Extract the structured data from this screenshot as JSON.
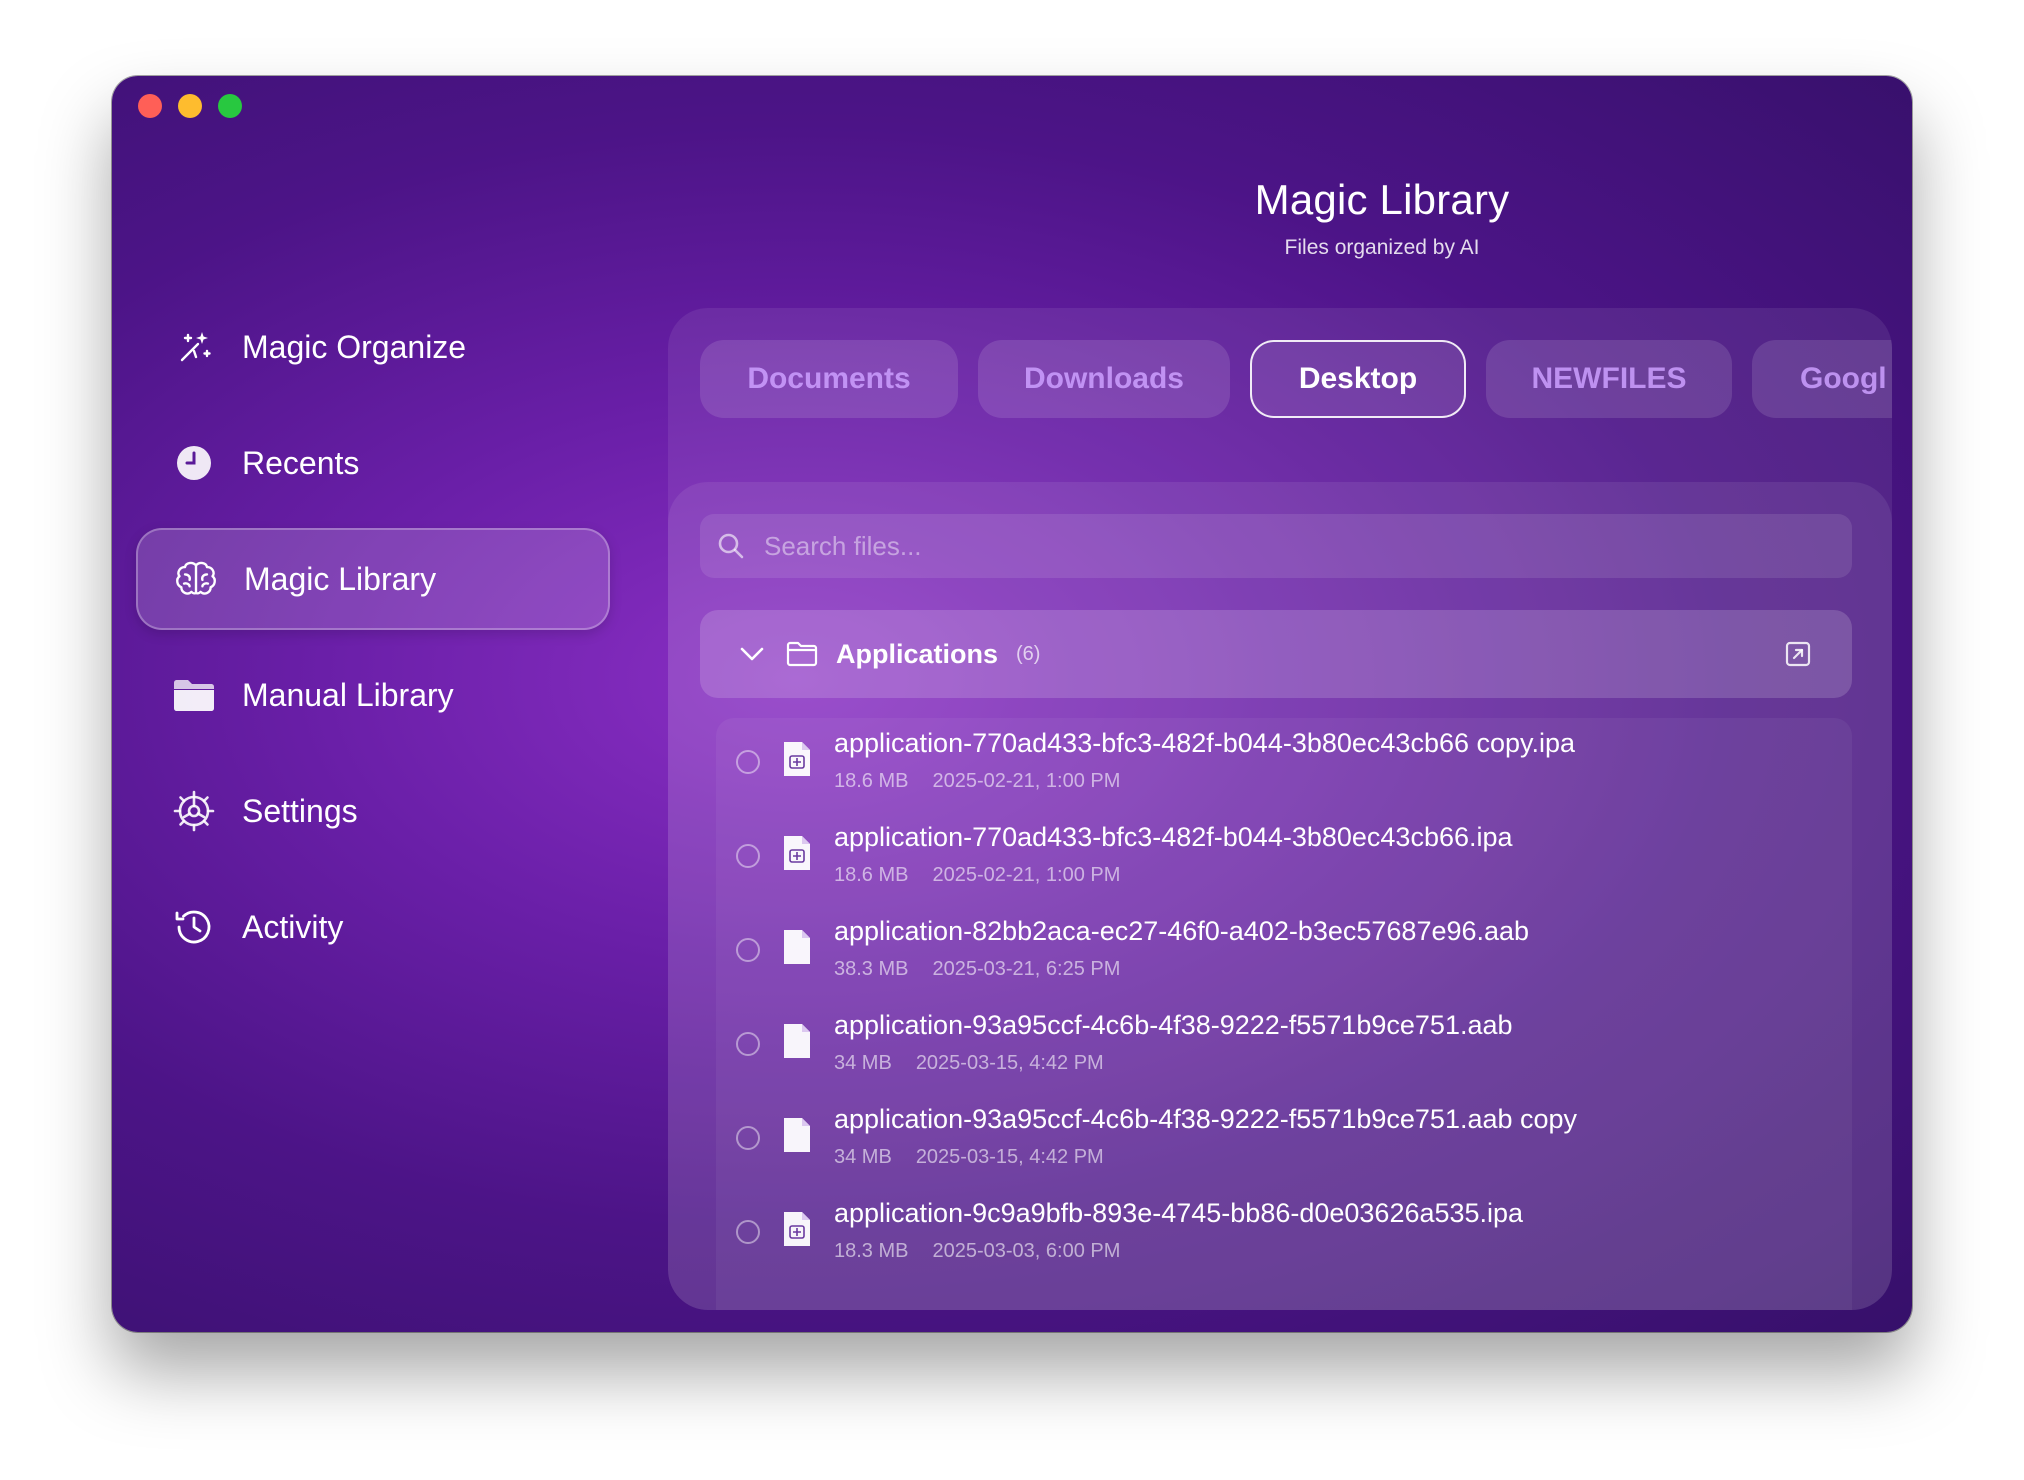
{
  "window": {
    "traffic_lights": {
      "close": "#ff5f57",
      "minimize": "#febc2e",
      "zoom": "#28c840"
    }
  },
  "header": {
    "title": "Magic Library",
    "subtitle": "Files organized by AI"
  },
  "sidebar": {
    "items": [
      {
        "label": "Magic Organize",
        "icon": "magic-wand-icon",
        "active": false
      },
      {
        "label": "Recents",
        "icon": "clock-icon",
        "active": false
      },
      {
        "label": "Magic Library",
        "icon": "brain-icon",
        "active": true
      },
      {
        "label": "Manual Library",
        "icon": "folder-icon",
        "active": false
      },
      {
        "label": "Settings",
        "icon": "gear-icon",
        "active": false
      },
      {
        "label": "Activity",
        "icon": "history-icon",
        "active": false
      }
    ]
  },
  "tabs": [
    {
      "label": "Documents",
      "active": false
    },
    {
      "label": "Downloads",
      "active": false
    },
    {
      "label": "Desktop",
      "active": true
    },
    {
      "label": "NEWFILES",
      "active": false
    },
    {
      "label": "Googl",
      "active": false
    }
  ],
  "search": {
    "placeholder": "Search files...",
    "value": ""
  },
  "group": {
    "name": "Applications",
    "count": "(6)",
    "expanded": true,
    "files": [
      {
        "name": "application-770ad433-bfc3-482f-b044-3b80ec43cb66 copy.ipa",
        "size": "18.6 MB",
        "date": "2025-02-21, 1:00 PM",
        "icon": "ipa-file-icon"
      },
      {
        "name": "application-770ad433-bfc3-482f-b044-3b80ec43cb66.ipa",
        "size": "18.6 MB",
        "date": "2025-02-21, 1:00 PM",
        "icon": "ipa-file-icon"
      },
      {
        "name": "application-82bb2aca-ec27-46f0-a402-b3ec57687e96.aab",
        "size": "38.3 MB",
        "date": "2025-03-21, 6:25 PM",
        "icon": "blank-file-icon"
      },
      {
        "name": "application-93a95ccf-4c6b-4f38-9222-f5571b9ce751.aab",
        "size": "34 MB",
        "date": "2025-03-15, 4:42 PM",
        "icon": "blank-file-icon"
      },
      {
        "name": "application-93a95ccf-4c6b-4f38-9222-f5571b9ce751.aab copy",
        "size": "34 MB",
        "date": "2025-03-15, 4:42 PM",
        "icon": "blank-file-icon"
      },
      {
        "name": "application-9c9a9bfb-893e-4745-bb86-d0e03626a535.ipa",
        "size": "18.3 MB",
        "date": "2025-03-03, 6:00 PM",
        "icon": "ipa-file-icon"
      }
    ]
  },
  "colors": {
    "accent": "#7b2fbf",
    "window_bg": "#4c1487",
    "tab_inactive_text": "#cda0ff"
  }
}
